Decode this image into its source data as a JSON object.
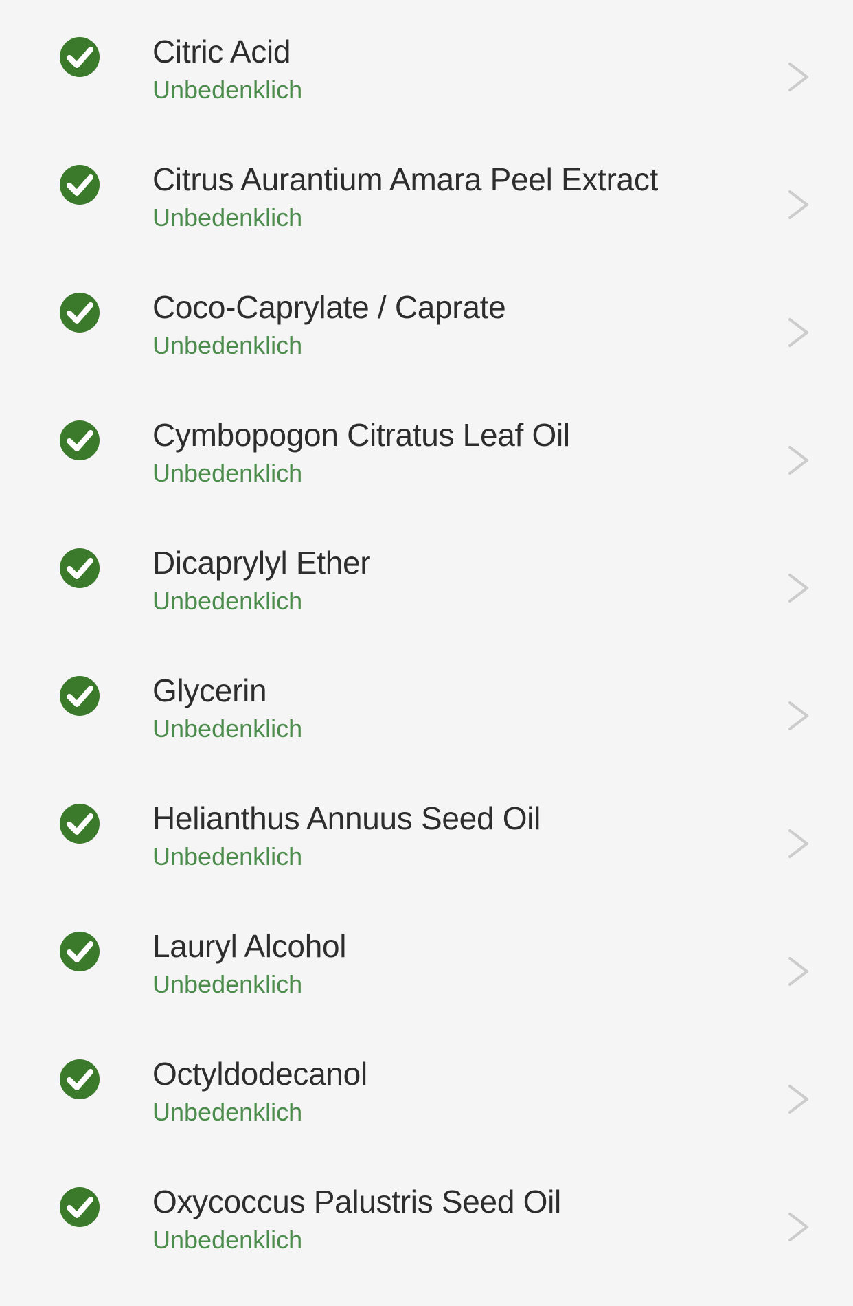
{
  "colors": {
    "background": "#f5f5f5",
    "check_fill": "#3a7a2a",
    "status_text": "#4c8c4c",
    "name_text": "#2d2d2d",
    "chevron": "#cccccc"
  },
  "ingredients": [
    {
      "name": "Citric Acid",
      "status": "Unbedenklich",
      "icon": "check-circle-icon"
    },
    {
      "name": "Citrus Aurantium Amara Peel Extract",
      "status": "Unbedenklich",
      "icon": "check-circle-icon"
    },
    {
      "name": "Coco-Caprylate / Caprate",
      "status": "Unbedenklich",
      "icon": "check-circle-icon"
    },
    {
      "name": "Cymbopogon Citratus Leaf Oil",
      "status": "Unbedenklich",
      "icon": "check-circle-icon"
    },
    {
      "name": "Dicaprylyl Ether",
      "status": "Unbedenklich",
      "icon": "check-circle-icon"
    },
    {
      "name": "Glycerin",
      "status": "Unbedenklich",
      "icon": "check-circle-icon"
    },
    {
      "name": "Helianthus Annuus Seed Oil",
      "status": "Unbedenklich",
      "icon": "check-circle-icon"
    },
    {
      "name": "Lauryl Alcohol",
      "status": "Unbedenklich",
      "icon": "check-circle-icon"
    },
    {
      "name": "Octyldodecanol",
      "status": "Unbedenklich",
      "icon": "check-circle-icon"
    },
    {
      "name": "Oxycoccus Palustris Seed Oil",
      "status": "Unbedenklich",
      "icon": "check-circle-icon"
    }
  ]
}
